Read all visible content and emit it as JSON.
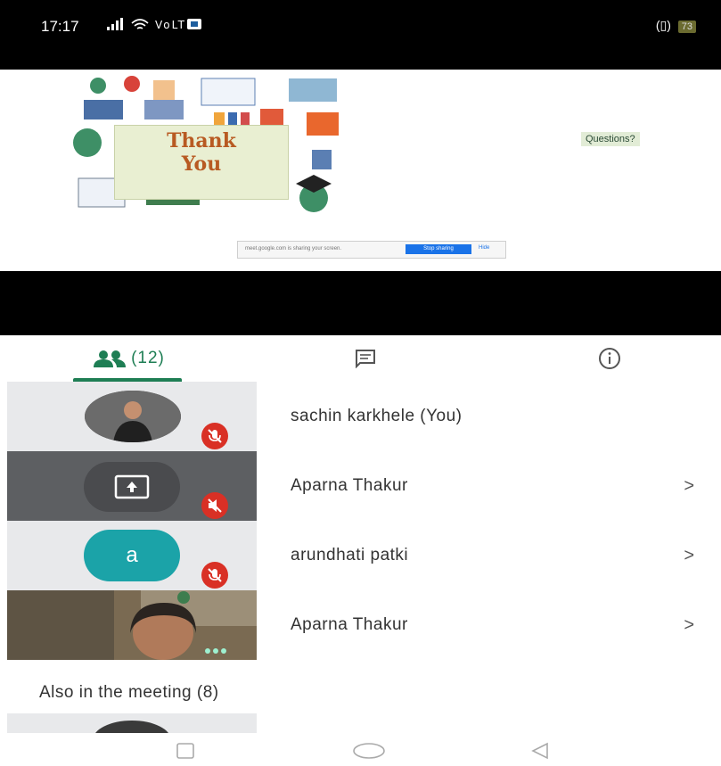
{
  "status_bar": {
    "time": "17:17",
    "icons": "..ıl ≈ ⌘",
    "right_icon": "(▯)",
    "battery": "73"
  },
  "slide": {
    "thank_line1": "Thank",
    "thank_line2": "You",
    "questions_label": "Questions?",
    "share_bar": {
      "text": "meet.google.com is sharing your screen.",
      "stop_label": "Stop sharing",
      "hide_label": "Hide"
    }
  },
  "tabs": {
    "people_count": "(12)"
  },
  "participants": [
    {
      "name": "sachin karkhele (You)",
      "tile": "photo",
      "muted": true,
      "chevron": ""
    },
    {
      "name": "Aparna Thakur",
      "tile": "screen-share",
      "muted": true,
      "chevron": ">"
    },
    {
      "name": "arundhati patki",
      "tile": "avatar",
      "avatar_letter": "a",
      "muted": true,
      "chevron": ">"
    },
    {
      "name": "Aparna Thakur",
      "tile": "video",
      "muted": false,
      "chevron": ">"
    }
  ],
  "also_in_meeting": "Also in the meeting (8)",
  "colors": {
    "accent": "#1e7e54",
    "mute_red": "#d93025",
    "avatar_teal": "#1ba3a8"
  }
}
